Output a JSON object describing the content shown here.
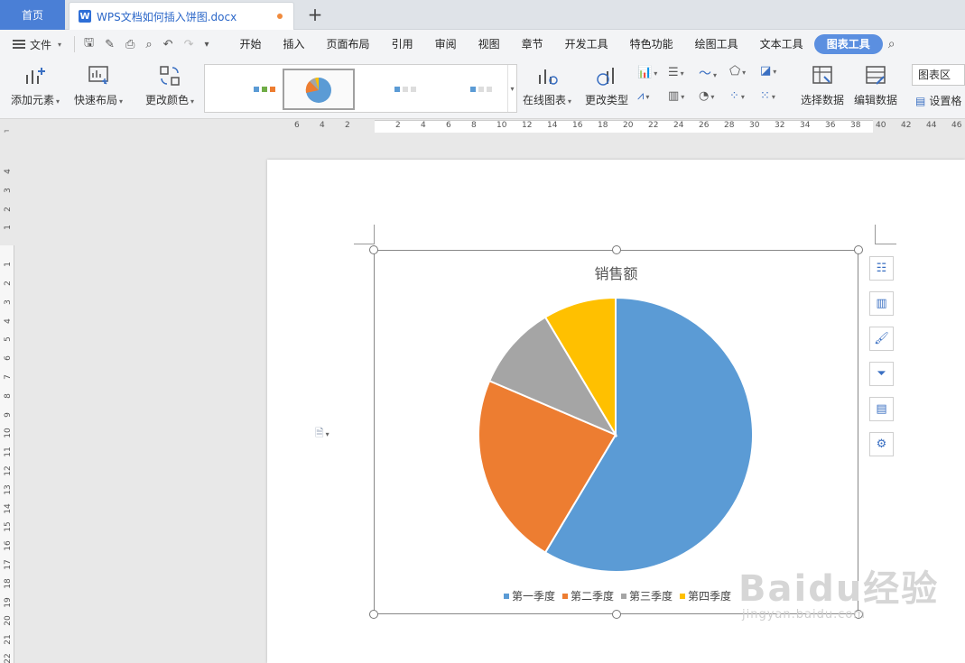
{
  "tabs": {
    "home": "首页",
    "doc_title": "WPS文档如何插入饼图.docx",
    "new_tab": "+"
  },
  "menu": {
    "file": "文件",
    "items": [
      "开始",
      "插入",
      "页面布局",
      "引用",
      "审阅",
      "视图",
      "章节",
      "开发工具",
      "特色功能",
      "绘图工具",
      "文本工具",
      "图表工具"
    ],
    "active": "图表工具"
  },
  "ribbon": {
    "add_element": "添加元素",
    "quick_layout": "快速布局",
    "change_color": "更改颜色",
    "online_chart": "在线图表",
    "change_type": "更改类型",
    "select_data": "选择数据",
    "edit_data": "编辑数据",
    "chart_area": "图表区",
    "set_format": "设置格"
  },
  "hruler_ticks": [
    "6",
    "4",
    "2",
    "2",
    "4",
    "6",
    "8",
    "10",
    "12",
    "14",
    "16",
    "18",
    "20",
    "22",
    "24",
    "26",
    "28",
    "30",
    "32",
    "34",
    "36",
    "38",
    "40",
    "42",
    "44",
    "46"
  ],
  "vruler_ticks": [
    "4",
    "3",
    "2",
    "1",
    "1",
    "2",
    "3",
    "4",
    "5",
    "6",
    "7",
    "8",
    "9",
    "10",
    "11",
    "12",
    "13",
    "14",
    "15",
    "16",
    "17",
    "18",
    "19",
    "20",
    "21",
    "22"
  ],
  "chart_data": {
    "type": "pie",
    "title": "销售额",
    "categories": [
      "第一季度",
      "第二季度",
      "第三季度",
      "第四季度"
    ],
    "values": [
      8.2,
      3.2,
      1.4,
      1.2
    ],
    "colors": [
      "#5b9bd5",
      "#ed7d31",
      "#a5a5a5",
      "#ffc000"
    ],
    "legend_position": "bottom"
  },
  "watermark": {
    "main": "Baidu经验",
    "sub": "jingyan.baidu.com"
  },
  "colors": {
    "accent": "#4a7fd6",
    "active_tab": "#5b8fe0"
  }
}
